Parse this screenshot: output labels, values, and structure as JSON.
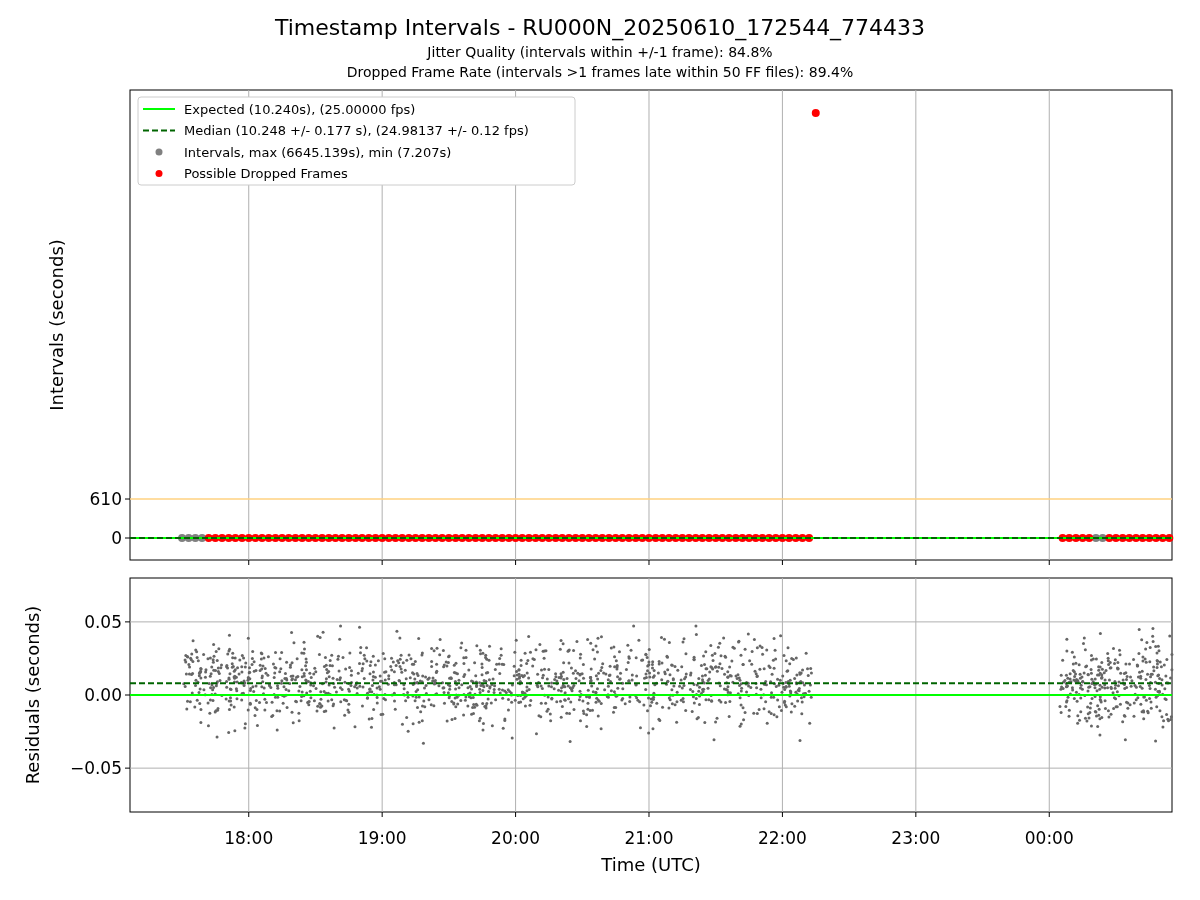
{
  "figure": {
    "title": "Timestamp Intervals - RU000N_20250610_172544_774433",
    "subtitles": [
      "Jitter Quality (intervals within +/-1 frame): 84.8%",
      "Dropped Frame Rate (intervals >1 frames late within 50 FF files): 89.4%"
    ]
  },
  "intervals_plot": {
    "chart_data": {
      "type": "scatter",
      "ylabel": "Intervals (seconds)",
      "xlim": [
        17.11,
        24.92
      ],
      "ylim": [
        -344,
        7010
      ],
      "yticks": [
        0,
        610
      ],
      "grid": true,
      "legend": true,
      "ref_lines": [
        {
          "axis": "y",
          "value": 0,
          "color": "#00ff00",
          "label": "Expected (10.240s), (25.00000 fps)"
        },
        {
          "axis": "y",
          "value": 0.008,
          "color": "#006400",
          "label": "Median (10.248 +/- 0.177 s), (24.98137 +/- 0.12 fps)"
        },
        {
          "axis": "y",
          "value": 610,
          "color": "#ffd280"
        }
      ],
      "x": [
        17.5,
        17.55,
        17.6,
        17.65,
        17.7,
        17.75,
        17.8,
        17.85,
        17.9,
        17.95,
        18,
        18.05,
        18.1,
        18.15,
        18.2,
        18.25,
        18.3,
        18.35,
        18.4,
        18.45,
        18.5,
        18.55,
        18.6,
        18.65,
        18.7,
        18.75,
        18.8,
        18.85,
        18.9,
        18.95,
        19,
        19.05,
        19.1,
        19.15,
        19.2,
        19.25,
        19.3,
        19.35,
        19.4,
        19.45,
        19.5,
        19.55,
        19.6,
        19.65,
        19.7,
        19.75,
        19.8,
        19.85,
        19.9,
        19.95,
        20,
        20.05,
        20.1,
        20.15,
        20.2,
        20.25,
        20.3,
        20.35,
        20.4,
        20.45,
        20.5,
        20.55,
        20.6,
        20.65,
        20.7,
        20.75,
        20.8,
        20.85,
        20.9,
        20.95,
        21,
        21.05,
        21.1,
        21.15,
        21.2,
        21.25,
        21.3,
        21.35,
        21.4,
        21.45,
        21.5,
        21.55,
        21.6,
        21.65,
        21.7,
        21.75,
        21.8,
        21.85,
        21.9,
        21.95,
        22,
        22.05,
        22.1,
        22.15,
        22.2,
        22.25,
        24.1,
        24.15,
        24.2,
        24.25,
        24.3,
        24.35,
        24.4,
        24.45,
        24.5,
        24.55,
        24.6,
        24.65,
        24.7,
        24.75,
        24.8,
        24.85,
        24.9
      ],
      "series": [
        {
          "name": "Intervals, max (6645.139s), min (7.207s)",
          "color": "#808080",
          "values": [
            0,
            0,
            0,
            0,
            null,
            null,
            null,
            null,
            null,
            null,
            null,
            null,
            null,
            null,
            null,
            null,
            null,
            null,
            null,
            null,
            null,
            null,
            null,
            null,
            null,
            null,
            null,
            null,
            null,
            null,
            null,
            null,
            null,
            null,
            null,
            null,
            null,
            null,
            null,
            null,
            null,
            null,
            null,
            null,
            null,
            null,
            null,
            null,
            null,
            null,
            null,
            null,
            null,
            null,
            null,
            null,
            null,
            null,
            null,
            null,
            null,
            null,
            null,
            null,
            null,
            null,
            null,
            null,
            null,
            null,
            null,
            null,
            null,
            null,
            null,
            null,
            null,
            null,
            null,
            null,
            null,
            null,
            null,
            null,
            null,
            null,
            null,
            null,
            null,
            null,
            null,
            null,
            null,
            null,
            null,
            null,
            null,
            null,
            null,
            null,
            null,
            0,
            0,
            null,
            null,
            null,
            null,
            null,
            null,
            null,
            null,
            null,
            null
          ]
        },
        {
          "name": "Possible Dropped Frames",
          "color": "#ff0000",
          "values": [
            null,
            null,
            null,
            null,
            0,
            0,
            0,
            0,
            0,
            0,
            0,
            0,
            0,
            0,
            0,
            0,
            0,
            0,
            0,
            0,
            0,
            0,
            0,
            0,
            0,
            0,
            0,
            0,
            0,
            0,
            0,
            0,
            0,
            0,
            0,
            0,
            0,
            0,
            0,
            0,
            0,
            0,
            0,
            0,
            0,
            0,
            0,
            0,
            0,
            0,
            0,
            0,
            0,
            0,
            0,
            0,
            0,
            0,
            0,
            0,
            0,
            0,
            0,
            0,
            0,
            0,
            0,
            0,
            0,
            0,
            0,
            0,
            0,
            0,
            0,
            0,
            0,
            0,
            0,
            0,
            0,
            0,
            0,
            0,
            0,
            0,
            0,
            0,
            0,
            0,
            0,
            0,
            0,
            0,
            0,
            6650,
            0,
            0,
            0,
            0,
            0,
            null,
            null,
            0,
            0,
            0,
            0,
            0,
            0,
            0,
            0,
            0,
            0
          ]
        }
      ]
    }
  },
  "residuals_plot": {
    "chart_data": {
      "type": "scatter",
      "xlabel": "Time (UTC)",
      "ylabel": "Residuals (seconds)",
      "xlim": [
        17.11,
        24.92
      ],
      "ylim": [
        -0.08,
        0.08
      ],
      "grid": true,
      "xticks": [
        {
          "value": 18,
          "label": "18:00"
        },
        {
          "value": 19,
          "label": "19:00"
        },
        {
          "value": 20,
          "label": "20:00"
        },
        {
          "value": 21,
          "label": "21:00"
        },
        {
          "value": 22,
          "label": "22:00"
        },
        {
          "value": 23,
          "label": "23:00"
        },
        {
          "value": 24,
          "label": "00:00"
        }
      ],
      "yticks": [
        {
          "value": -0.05,
          "label": "−0.05"
        },
        {
          "value": 0,
          "label": "0.00"
        },
        {
          "value": 0.05,
          "label": "0.05"
        }
      ],
      "ref_lines": [
        {
          "axis": "y",
          "value": 0,
          "color": "#00ff00"
        },
        {
          "axis": "y",
          "value": 0.008,
          "color": "#006400"
        }
      ]
    }
  }
}
